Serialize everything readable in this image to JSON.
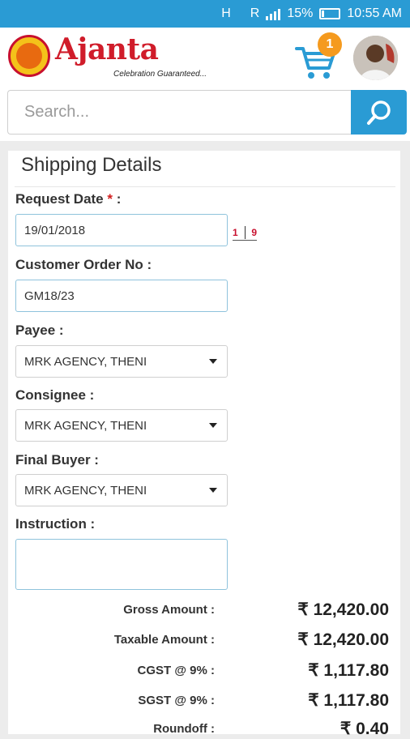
{
  "status": {
    "network_h": "H",
    "network_r": "R",
    "battery": "15%",
    "time": "10:55 AM"
  },
  "header": {
    "brand_name": "Ajanta",
    "tagline": "Celebration Guaranteed...",
    "cart_count": "1"
  },
  "search": {
    "placeholder": "Search..."
  },
  "form": {
    "title": "Shipping Details",
    "request_date_label": "Request Date",
    "required_mark": "*",
    "request_date_colon": ":",
    "request_date_value": "19/01/2018",
    "calendar_day_1": "1",
    "calendar_day_2": "9",
    "customer_order_label": "Customer Order No   :",
    "customer_order_value": "GM18/23",
    "payee_label": "Payee   :",
    "payee_value": "MRK AGENCY, THENI",
    "consignee_label": "Consignee   :",
    "consignee_value": "MRK AGENCY, THENI",
    "final_buyer_label": "Final Buyer   :",
    "final_buyer_value": "MRK AGENCY, THENI",
    "instruction_label": "Instruction   :",
    "instruction_value": ""
  },
  "totals": [
    {
      "label": "Gross Amount   :",
      "value": "₹ 12,420.00"
    },
    {
      "label": "Taxable Amount :",
      "value": "₹ 12,420.00"
    },
    {
      "label": "CGST @ 9% :",
      "value": "₹ 1,117.80"
    },
    {
      "label": "SGST @ 9% :",
      "value": "₹ 1,117.80"
    },
    {
      "label": "Roundoff :",
      "value": "₹ 0.40"
    }
  ],
  "colors": {
    "accent": "#2a9bd4",
    "brand_red": "#d01c2a",
    "badge_orange": "#f59a1e"
  },
  "icons": {
    "cart": "shopping-cart-icon",
    "search": "search-icon",
    "calendar": "calendar-icon",
    "dropdown": "dropdown-caret-icon"
  }
}
